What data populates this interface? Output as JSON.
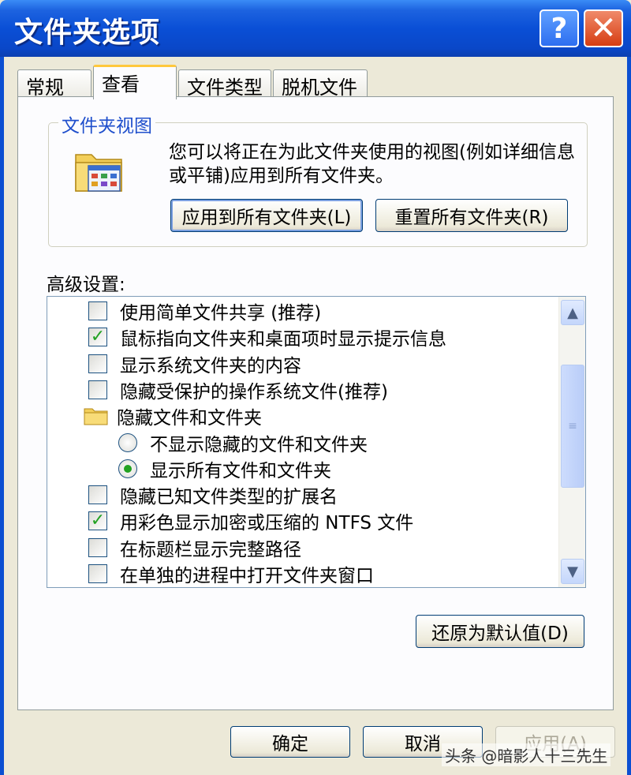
{
  "window": {
    "title": "文件夹选项",
    "help_symbol": "?",
    "close_symbol": "✕"
  },
  "tabs": [
    {
      "label": "常规",
      "active": false
    },
    {
      "label": "查看",
      "active": true
    },
    {
      "label": "文件类型",
      "active": false
    },
    {
      "label": "脱机文件",
      "active": false
    }
  ],
  "folder_view": {
    "legend": "文件夹视图",
    "description": "您可以将正在为此文件夹使用的视图(例如详细信息或平铺)应用到所有文件夹。",
    "apply_all_button": "应用到所有文件夹(L)",
    "reset_all_button": "重置所有文件夹(R)"
  },
  "advanced": {
    "label": "高级设置:",
    "items": [
      {
        "type": "checkbox",
        "label": "使用简单文件共享 (推荐)",
        "checked": false
      },
      {
        "type": "checkbox",
        "label": "鼠标指向文件夹和桌面项时显示提示信息",
        "checked": true
      },
      {
        "type": "checkbox",
        "label": "显示系统文件夹的内容",
        "checked": false
      },
      {
        "type": "checkbox",
        "label": "隐藏受保护的操作系统文件(推荐)",
        "checked": false
      },
      {
        "type": "folder",
        "label": "隐藏文件和文件夹"
      },
      {
        "type": "radio",
        "label": "不显示隐藏的文件和文件夹",
        "checked": false
      },
      {
        "type": "radio",
        "label": "显示所有文件和文件夹",
        "checked": true
      },
      {
        "type": "checkbox",
        "label": "隐藏已知文件类型的扩展名",
        "checked": false
      },
      {
        "type": "checkbox",
        "label": "用彩色显示加密或压缩的 NTFS 文件",
        "checked": true
      },
      {
        "type": "checkbox",
        "label": "在标题栏显示完整路径",
        "checked": false
      },
      {
        "type": "checkbox",
        "label": "在单独的进程中打开文件夹窗口",
        "checked": false
      }
    ],
    "check_symbol": "✓",
    "scroll_up_symbol": "▲",
    "scroll_down_symbol": "▼",
    "scroll_grip": "≡"
  },
  "restore_defaults_button": "还原为默认值(D)",
  "footer": {
    "ok_button": "确定",
    "cancel_button": "取消",
    "apply_button": "应用(A)"
  },
  "watermark": "头条 @暗影人十三先生",
  "colors": {
    "title_bar": "#0a4fd6",
    "legend_text": "#1f4fcc",
    "check_mark": "#21a121",
    "active_tab_accent": "#ffc83c"
  }
}
